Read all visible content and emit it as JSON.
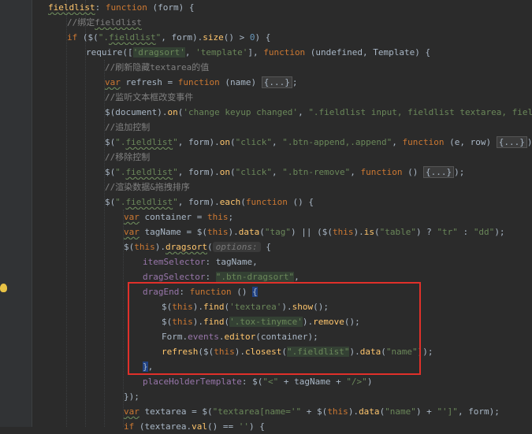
{
  "editor": {
    "lines": [
      {
        "indent": 61,
        "segs": [
          [
            "fieldlist",
            "fn wavy"
          ],
          [
            ": ",
            ""
          ],
          [
            "function",
            "kw"
          ],
          [
            " (form) {",
            ""
          ]
        ]
      },
      {
        "indent": 85,
        "segs": [
          [
            "//绑定",
            "cm"
          ],
          [
            "fieldlist",
            "cm wavy"
          ]
        ]
      },
      {
        "indent": 85,
        "segs": [
          [
            "if",
            "kw"
          ],
          [
            " ($(",
            ""
          ],
          [
            "\".",
            "str"
          ],
          [
            "fieldlist",
            "str wavy"
          ],
          [
            "\"",
            "str"
          ],
          [
            ", form).",
            ""
          ],
          [
            "size",
            "fn"
          ],
          [
            "() > ",
            ""
          ],
          [
            "0",
            "num"
          ],
          [
            ") {",
            ""
          ]
        ]
      },
      {
        "indent": 109,
        "segs": [
          [
            "require([",
            ""
          ],
          [
            "'dragsort'",
            "str hl"
          ],
          [
            ", ",
            ""
          ],
          [
            "'template'",
            "str"
          ],
          [
            "], ",
            ""
          ],
          [
            "function",
            "kw"
          ],
          [
            " (undefined, Template) {",
            ""
          ]
        ]
      },
      {
        "indent": 133,
        "segs": [
          [
            "//刷新隐藏textarea的值",
            "cm"
          ]
        ]
      },
      {
        "indent": 133,
        "segs": [
          [
            "var",
            "kw wavy"
          ],
          [
            " refresh = ",
            ""
          ],
          [
            "function",
            "kw"
          ],
          [
            " (name) ",
            ""
          ],
          [
            "{...}",
            "fold"
          ],
          [
            ";",
            ""
          ]
        ]
      },
      {
        "indent": 133,
        "segs": [
          [
            "//监听文本框改变事件",
            "cm"
          ]
        ]
      },
      {
        "indent": 133,
        "segs": [
          [
            "$(document).",
            ""
          ],
          [
            "on",
            "fn"
          ],
          [
            "(",
            ""
          ],
          [
            "'change keyup changed'",
            "str"
          ],
          [
            ", ",
            ""
          ],
          [
            "\".fieldlist input, fieldlist textarea, fieldlist se",
            "str"
          ]
        ]
      },
      {
        "indent": 133,
        "segs": [
          [
            "//追加控制",
            "cm"
          ]
        ]
      },
      {
        "indent": 133,
        "segs": [
          [
            "$(",
            ""
          ],
          [
            "\".",
            "str"
          ],
          [
            "fieldlist",
            "str wavy"
          ],
          [
            "\"",
            "str"
          ],
          [
            ", form).",
            ""
          ],
          [
            "on",
            "fn"
          ],
          [
            "(",
            ""
          ],
          [
            "\"click\"",
            "str"
          ],
          [
            ", ",
            ""
          ],
          [
            "\".btn-append,.append\"",
            "str"
          ],
          [
            ", ",
            ""
          ],
          [
            "function",
            "kw"
          ],
          [
            " (e, row) ",
            ""
          ],
          [
            "{...}",
            "fold"
          ],
          [
            ");",
            ""
          ]
        ]
      },
      {
        "indent": 133,
        "segs": [
          [
            "//移除控制",
            "cm"
          ]
        ]
      },
      {
        "indent": 133,
        "segs": [
          [
            "$(",
            ""
          ],
          [
            "\".",
            "str"
          ],
          [
            "fieldlist",
            "str wavy"
          ],
          [
            "\"",
            "str"
          ],
          [
            ", form).",
            ""
          ],
          [
            "on",
            "fn"
          ],
          [
            "(",
            ""
          ],
          [
            "\"click\"",
            "str"
          ],
          [
            ", ",
            ""
          ],
          [
            "\".btn-remove\"",
            "str"
          ],
          [
            ", ",
            ""
          ],
          [
            "function",
            "kw"
          ],
          [
            " () ",
            ""
          ],
          [
            "{...}",
            "fold"
          ],
          [
            ");",
            ""
          ]
        ]
      },
      {
        "indent": 133,
        "segs": [
          [
            "//渲染数据&拖拽排序",
            "cm"
          ]
        ]
      },
      {
        "indent": 133,
        "segs": [
          [
            "$(",
            ""
          ],
          [
            "\".",
            "str"
          ],
          [
            "fieldlist",
            "str wavy"
          ],
          [
            "\"",
            "str"
          ],
          [
            ", form).",
            ""
          ],
          [
            "each",
            "fn"
          ],
          [
            "(",
            ""
          ],
          [
            "function",
            "kw"
          ],
          [
            " () {",
            ""
          ]
        ]
      },
      {
        "indent": 157,
        "segs": [
          [
            "var",
            "kw wavy"
          ],
          [
            " container = ",
            ""
          ],
          [
            "this",
            "kw"
          ],
          [
            ";",
            ""
          ]
        ]
      },
      {
        "indent": 157,
        "segs": [
          [
            "var",
            "kw wavy"
          ],
          [
            " tagName = $(",
            ""
          ],
          [
            "this",
            "kw"
          ],
          [
            ").",
            ""
          ],
          [
            "data",
            "fn"
          ],
          [
            "(",
            ""
          ],
          [
            "\"tag\"",
            "str"
          ],
          [
            ") || ($(",
            ""
          ],
          [
            "this",
            "kw"
          ],
          [
            ").",
            ""
          ],
          [
            "is",
            "fn"
          ],
          [
            "(",
            ""
          ],
          [
            "\"table\"",
            "str"
          ],
          [
            ") ? ",
            ""
          ],
          [
            "\"tr\"",
            "str"
          ],
          [
            " : ",
            ""
          ],
          [
            "\"dd\"",
            "str"
          ],
          [
            ");",
            ""
          ]
        ]
      },
      {
        "indent": 157,
        "segs": [
          [
            "$(",
            ""
          ],
          [
            "this",
            "kw"
          ],
          [
            ").",
            ""
          ],
          [
            "dragsort",
            "fn wavy"
          ],
          [
            "(",
            ""
          ],
          [
            "options:",
            "hint"
          ],
          [
            " {",
            ""
          ]
        ]
      },
      {
        "indent": 181,
        "segs": [
          [
            "itemSelector",
            "prop"
          ],
          [
            ": tagName,",
            ""
          ]
        ]
      },
      {
        "indent": 181,
        "segs": [
          [
            "dragSelector",
            "prop"
          ],
          [
            ": ",
            ""
          ],
          [
            "\".btn-dragsort\"",
            "str hl"
          ],
          [
            ",",
            ""
          ]
        ]
      },
      {
        "indent": 181,
        "segs": [
          [
            "dragEnd",
            "prop"
          ],
          [
            ": ",
            ""
          ],
          [
            "function",
            "kw"
          ],
          [
            " () ",
            ""
          ],
          [
            "{",
            "sel"
          ]
        ]
      },
      {
        "indent": 205,
        "segs": [
          [
            "$(",
            ""
          ],
          [
            "this",
            "kw"
          ],
          [
            ").",
            ""
          ],
          [
            "find",
            "fn"
          ],
          [
            "(",
            ""
          ],
          [
            "'textarea'",
            "str"
          ],
          [
            ").",
            ""
          ],
          [
            "show",
            "fn"
          ],
          [
            "();",
            ""
          ]
        ]
      },
      {
        "indent": 205,
        "segs": [
          [
            "$(",
            ""
          ],
          [
            "this",
            "kw"
          ],
          [
            ").",
            ""
          ],
          [
            "find",
            "fn"
          ],
          [
            "(",
            ""
          ],
          [
            "'.tox-tinymce'",
            "str hl"
          ],
          [
            ").",
            ""
          ],
          [
            "remove",
            "fn"
          ],
          [
            "();",
            ""
          ]
        ]
      },
      {
        "indent": 205,
        "segs": [
          [
            "Form.",
            ""
          ],
          [
            "events",
            "prop"
          ],
          [
            ".",
            ""
          ],
          [
            "editor",
            "fn"
          ],
          [
            "(container);",
            ""
          ]
        ]
      },
      {
        "indent": 205,
        "segs": [
          [
            "refresh",
            "fn"
          ],
          [
            "($(",
            ""
          ],
          [
            "this",
            "kw"
          ],
          [
            ").",
            ""
          ],
          [
            "closest",
            "fn"
          ],
          [
            "(",
            ""
          ],
          [
            "\".fieldlist\"",
            "str hl"
          ],
          [
            ").",
            ""
          ],
          [
            "data",
            "fn"
          ],
          [
            "(",
            ""
          ],
          [
            "\"name\"",
            "str"
          ],
          [
            "));",
            ""
          ]
        ]
      },
      {
        "indent": 181,
        "segs": [
          [
            "}",
            "sel"
          ],
          [
            ",",
            ""
          ]
        ]
      },
      {
        "indent": 181,
        "segs": [
          [
            "placeHolderTemplate",
            "prop"
          ],
          [
            ": $(",
            ""
          ],
          [
            "\"<\"",
            "str"
          ],
          [
            " + tagName + ",
            ""
          ],
          [
            "\"/>\"",
            "str"
          ],
          [
            ")",
            ""
          ]
        ]
      },
      {
        "indent": 157,
        "segs": [
          [
            "});",
            ""
          ]
        ]
      },
      {
        "indent": 157,
        "segs": [
          [
            "var",
            "kw wavy"
          ],
          [
            " textarea = $(",
            ""
          ],
          [
            "\"textarea[name='\"",
            "str"
          ],
          [
            " + $(",
            ""
          ],
          [
            "this",
            "kw"
          ],
          [
            ").",
            ""
          ],
          [
            "data",
            "fn"
          ],
          [
            "(",
            ""
          ],
          [
            "\"name\"",
            "str"
          ],
          [
            ") + ",
            ""
          ],
          [
            "\"']\"",
            "str"
          ],
          [
            ", form);",
            ""
          ]
        ]
      },
      {
        "indent": 157,
        "segs": [
          [
            "if",
            "kw"
          ],
          [
            " (textarea.",
            ""
          ],
          [
            "val",
            "fn"
          ],
          [
            "() == ",
            ""
          ],
          [
            "''",
            "str"
          ],
          [
            ") {",
            ""
          ]
        ]
      }
    ]
  }
}
